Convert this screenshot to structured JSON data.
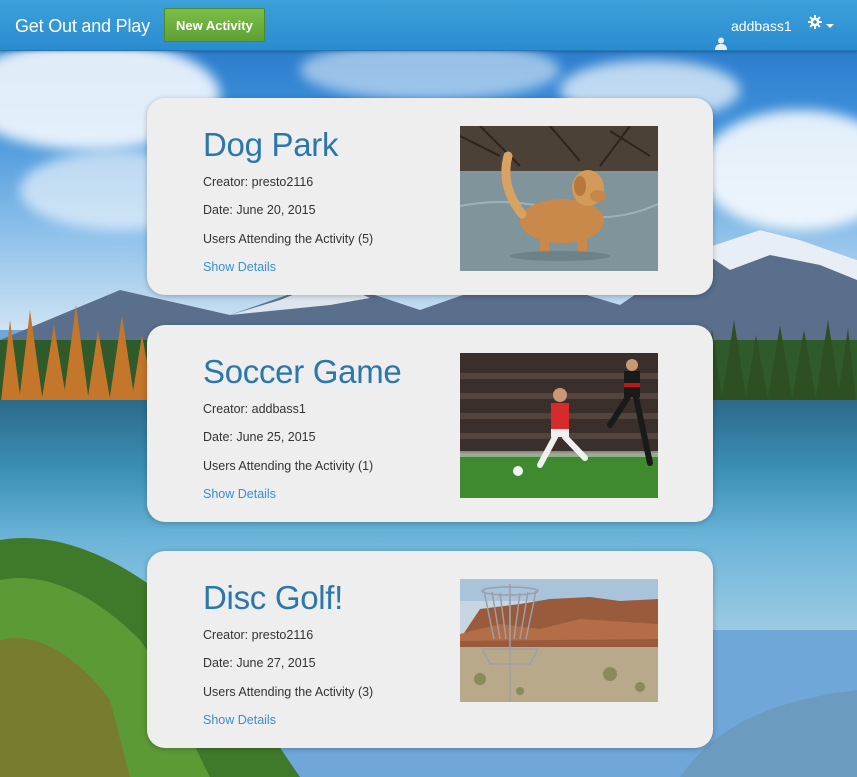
{
  "navbar": {
    "brand": "Get Out and Play",
    "new_activity_label": "New Activity",
    "username": "addbass1"
  },
  "activities": [
    {
      "title": "Dog Park",
      "creator": "Creator: presto2116",
      "date": "Date: June 20, 2015",
      "attending": "Users Attending the Activity (5)",
      "details_link": "Show Details"
    },
    {
      "title": "Soccer Game",
      "creator": "Creator: addbass1",
      "date": "Date: June 25, 2015",
      "attending": "Users Attending the Activity (1)",
      "details_link": "Show Details"
    },
    {
      "title": "Disc Golf!",
      "creator": "Creator: presto2116",
      "date": "Date: June 27, 2015",
      "attending": "Users Attending the Activity (3)",
      "details_link": "Show Details"
    }
  ],
  "colors": {
    "navbar": "#2a8ccf",
    "primary_button": "#5fa033",
    "title_text": "#2b77ab",
    "link": "#3a8fd0",
    "card_bg": "#eeeeee"
  }
}
